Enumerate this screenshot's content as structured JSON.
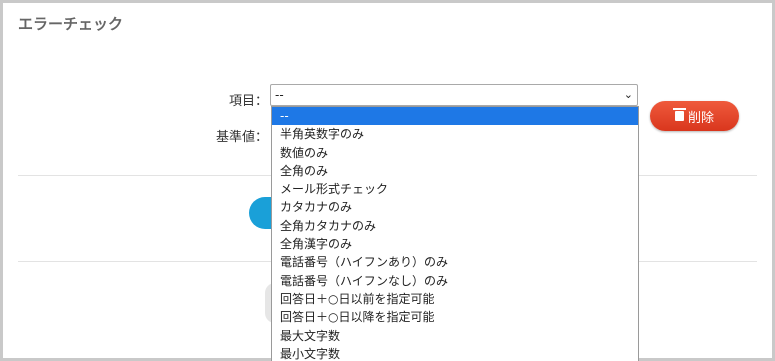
{
  "panel": {
    "title": "エラーチェック"
  },
  "form": {
    "item_label": "項目：",
    "criteria_label": "基準値：",
    "select_value": "--",
    "select_chevron": "⌄"
  },
  "delete_button": {
    "label": "削除",
    "icon": "trash-icon",
    "color": "#e2442a"
  },
  "dropdown": {
    "selected_color": "#1e78e6",
    "options": [
      "--",
      "半角英数字のみ",
      "数値のみ",
      "全角のみ",
      "メール形式チェック",
      "カタカナのみ",
      "全角カタカナのみ",
      "全角漢字のみ",
      "電話番号（ハイフンあり）のみ",
      "電話番号（ハイフンなし）のみ",
      "回答日＋○日以前を指定可能",
      "回答日＋○日以降を指定可能",
      "最大文字数",
      "最小文字数"
    ]
  }
}
